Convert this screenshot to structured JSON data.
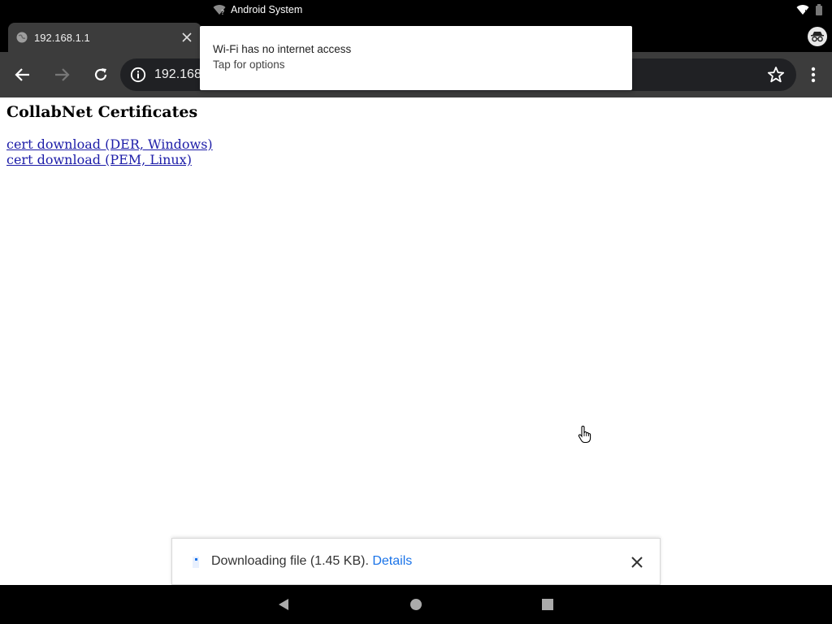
{
  "status_bar": {
    "notification_source": "Android System",
    "icons": [
      "wifi-question-icon",
      "wifi-icon",
      "battery-icon"
    ]
  },
  "tab": {
    "title": "192.168.1.1",
    "favicon": "globe-icon",
    "close_icon": "close-icon"
  },
  "toolbar": {
    "url": "192.168",
    "icons": [
      "back-arrow-icon",
      "forward-arrow-icon",
      "reload-icon",
      "info-icon",
      "star-icon",
      "more-vert-icon"
    ]
  },
  "notification": {
    "title": "Wi-Fi has no internet access",
    "text": "Tap for options"
  },
  "page": {
    "heading": "CollabNet Certificates",
    "links": [
      "cert download (DER, Windows)",
      "cert download (PEM, Linux)"
    ]
  },
  "download_bar": {
    "text": "Downloading file (1.45 KB).",
    "link_label": "Details"
  },
  "nav_bar": {
    "icons": [
      "back-triangle-icon",
      "home-circle-icon",
      "recents-square-icon"
    ]
  },
  "colors": {
    "chrome_dark": "#3c3c3c",
    "omnibox": "#202124",
    "link": "#1c1ca8",
    "accent": "#1a73e8"
  }
}
